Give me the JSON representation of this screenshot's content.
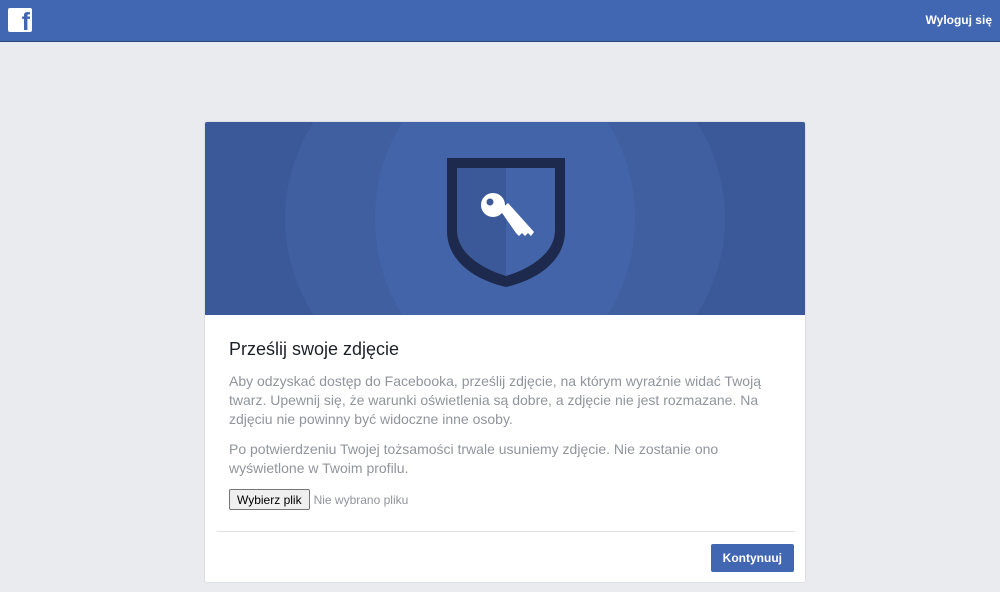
{
  "header": {
    "logo_letter": "f",
    "logout_label": "Wyloguj się"
  },
  "colors": {
    "brand_blue": "#4267b2",
    "hero_blue": "#3b5998",
    "shield_dark": "#1d2a4d"
  },
  "card": {
    "hero_icon": "shield-key-icon",
    "title": "Prześlij swoje zdjęcie",
    "paragraph1": "Aby odzyskać dostęp do Facebooka, prześlij zdjęcie, na którym wyraźnie widać Twoją twarz. Upewnij się, że warunki oświetlenia są dobre, a zdjęcie nie jest rozmazane. Na zdjęciu nie powinny być widoczne inne osoby.",
    "paragraph2": "Po potwierdzeniu Twojej tożsamości trwale usuniemy zdjęcie. Nie zostanie ono wyświetlone w Twoim profilu.",
    "file_button_label": "Wybierz plik",
    "file_status": "Nie wybrano pliku",
    "continue_label": "Kontynuuj"
  }
}
